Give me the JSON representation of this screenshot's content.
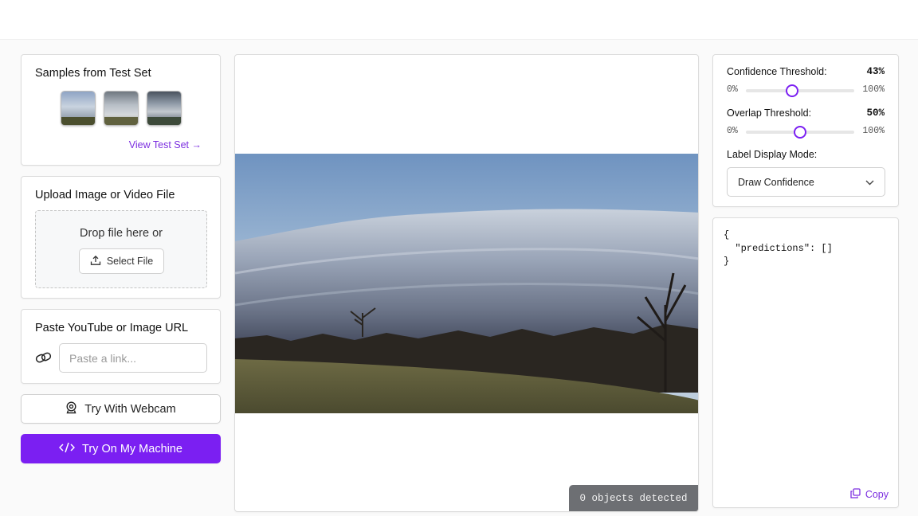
{
  "samples": {
    "title": "Samples from Test Set",
    "thumbnails": [
      "sample-1",
      "sample-2",
      "sample-3"
    ],
    "view_link": "View Test Set →"
  },
  "upload": {
    "title": "Upload Image or Video File",
    "drop_text": "Drop file here or",
    "select_label": "Select File"
  },
  "url": {
    "title": "Paste YouTube or Image URL",
    "placeholder": "Paste a link..."
  },
  "webcam": {
    "label": "Try With Webcam"
  },
  "machine": {
    "label": "Try On My Machine"
  },
  "viewer": {
    "objects_detected": "0 objects detected"
  },
  "settings": {
    "confidence": {
      "label": "Confidence Threshold:",
      "value": "43%",
      "fraction": 0.43,
      "min": "0%",
      "max": "100%"
    },
    "overlap": {
      "label": "Overlap Threshold:",
      "value": "50%",
      "fraction": 0.5,
      "min": "0%",
      "max": "100%"
    },
    "label_mode": {
      "label": "Label Display Mode:",
      "selected": "Draw Confidence"
    }
  },
  "output": {
    "json_text": "{\n  \"predictions\": []\n}",
    "copy_label": "Copy"
  },
  "colors": {
    "accent": "#7b1ff2",
    "badge_bg": "#6d6f73"
  }
}
